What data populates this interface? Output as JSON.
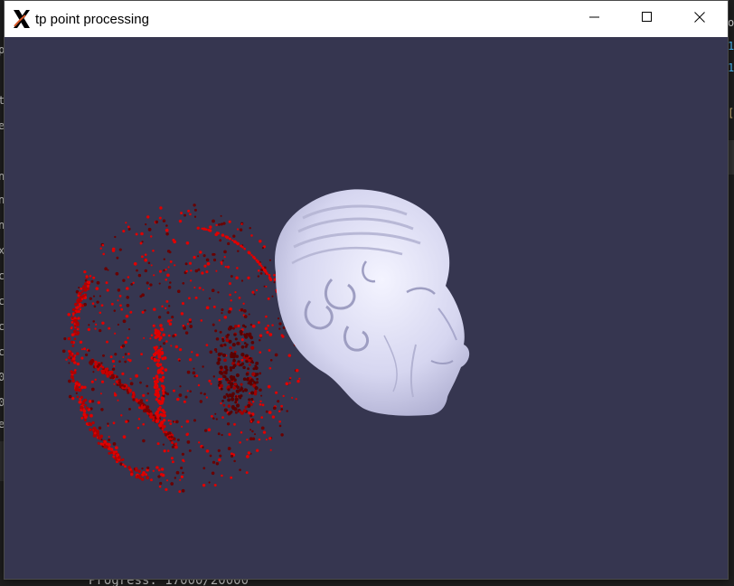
{
  "window": {
    "title": "tp point processing",
    "app_icon": "x-window-icon",
    "controls": {
      "minimize": "minimize-icon",
      "maximize": "maximize-icon",
      "close": "close-icon"
    }
  },
  "viewport": {
    "background_color": "#363650",
    "mesh_color": "#dcdcf5",
    "point_color": "#e00000",
    "point_dark_color": "#6a0000",
    "scene_objects": [
      "red-point-cloud",
      "white-head-mesh"
    ]
  },
  "terminal": {
    "progress_text": "Progress: 17000/20000"
  },
  "background_editor": {
    "left_glyphs": [
      "p",
      "t",
      "e",
      "n",
      "n",
      "n",
      "x",
      "c",
      "c",
      "c",
      "c",
      "0",
      "0",
      "e",
      "o"
    ],
    "right_glyphs": [
      "o",
      "1",
      "1",
      "["
    ],
    "right_glyph_colors": [
      "#d4d4d4",
      "#4fc1ff",
      "#4fc1ff",
      "#d7ba7d"
    ]
  }
}
